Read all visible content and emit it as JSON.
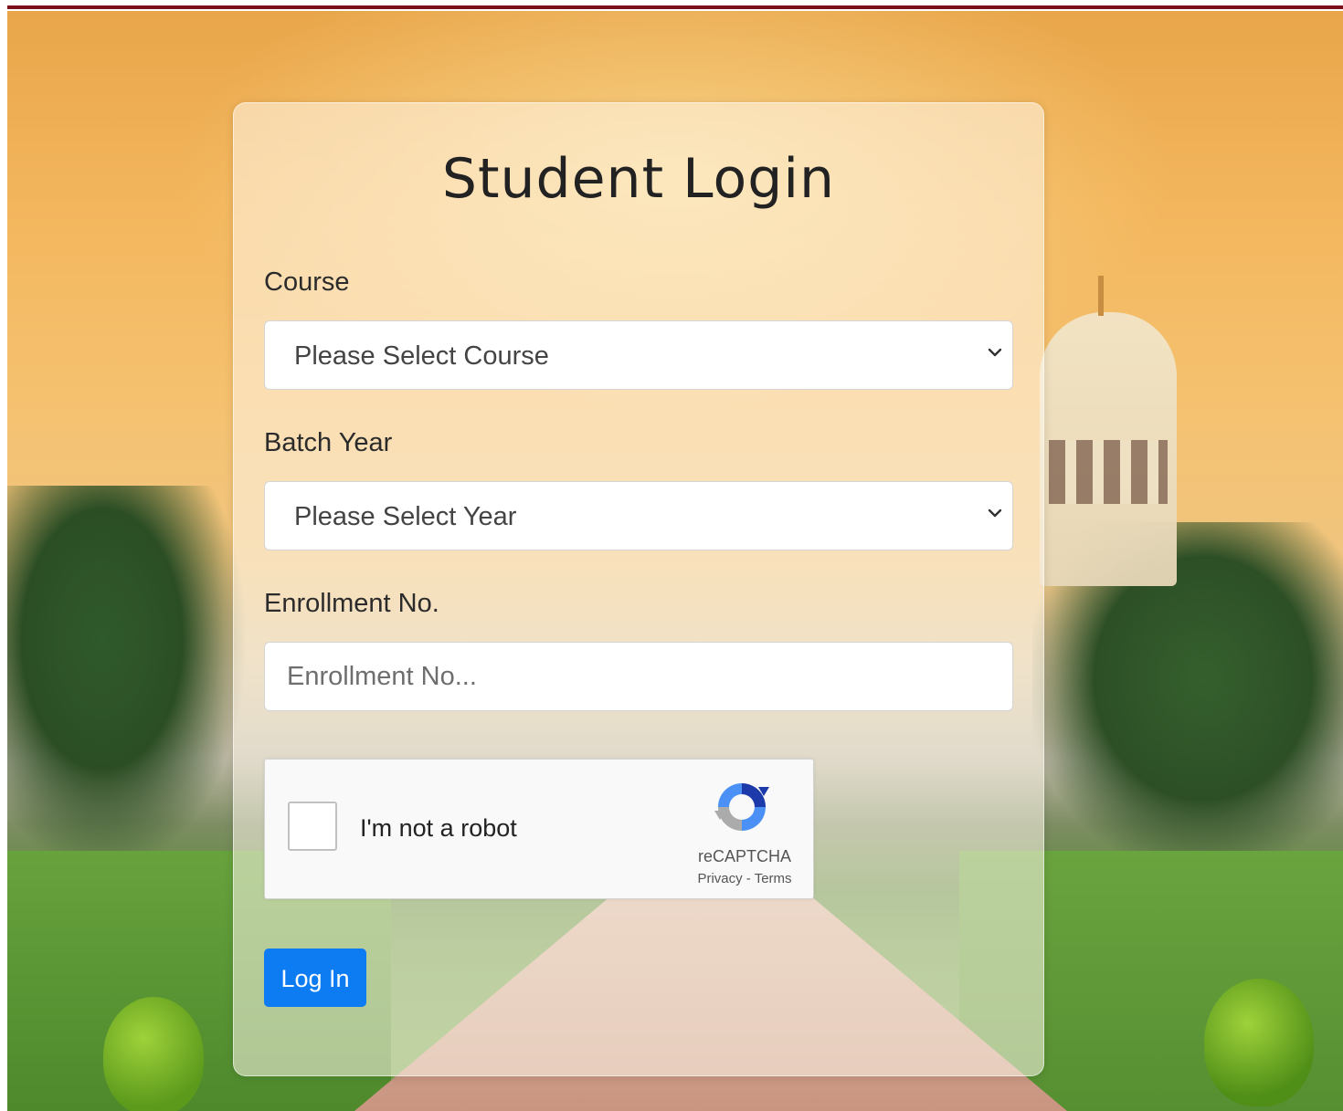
{
  "page_title": "Student Login",
  "form": {
    "course": {
      "label": "Course",
      "selected": "Please Select Course"
    },
    "batch_year": {
      "label": "Batch Year",
      "selected": "Please Select Year"
    },
    "enrollment": {
      "label": "Enrollment No.",
      "placeholder": "Enrollment No...",
      "value": ""
    }
  },
  "recaptcha": {
    "checkbox_label": "I'm not a robot",
    "brand": "reCAPTCHA",
    "privacy": "Privacy",
    "separator": " - ",
    "terms": "Terms"
  },
  "login_button": "Log In",
  "colors": {
    "accent": "#0d7cf2",
    "top_bar": "#7a1018"
  }
}
